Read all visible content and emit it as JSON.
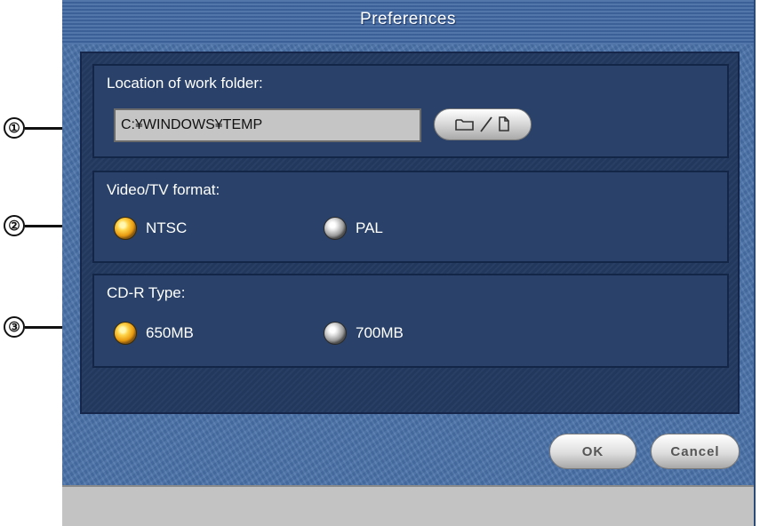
{
  "window": {
    "title": "Preferences"
  },
  "callouts": [
    "①",
    "②",
    "③"
  ],
  "work_folder": {
    "label": "Location of work folder:",
    "path_value": "C:¥WINDOWS¥TEMP",
    "browse_icons": [
      "folder-icon",
      "file-icon"
    ]
  },
  "video_format": {
    "label": "Video/TV format:",
    "options": [
      {
        "label": "NTSC",
        "selected": true
      },
      {
        "label": "PAL",
        "selected": false
      }
    ]
  },
  "cdr_type": {
    "label": "CD-R Type:",
    "options": [
      {
        "label": "650MB",
        "selected": true
      },
      {
        "label": "700MB",
        "selected": false
      }
    ]
  },
  "buttons": {
    "ok": "OK",
    "cancel": "Cancel"
  },
  "colors": {
    "window_bg": "#4a72aa",
    "panel_bg": "#243a60",
    "radio_selected": "#e89a10",
    "radio_unselected": "#9a9a9a"
  }
}
